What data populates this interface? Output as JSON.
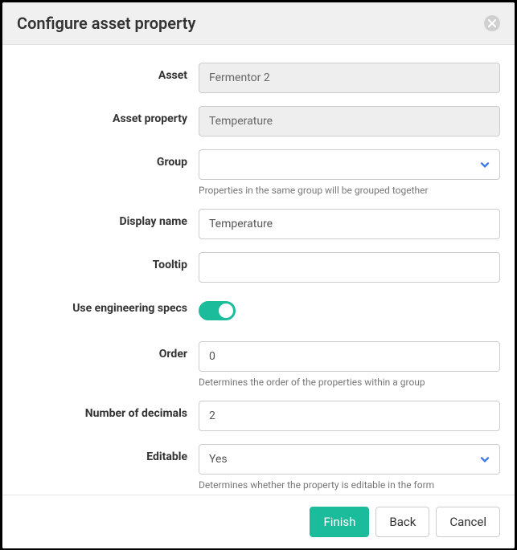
{
  "header": {
    "title": "Configure asset property"
  },
  "form": {
    "asset": {
      "label": "Asset",
      "value": "Fermentor 2"
    },
    "asset_property": {
      "label": "Asset property",
      "value": "Temperature"
    },
    "group": {
      "label": "Group",
      "value": "",
      "help": "Properties in the same group will be grouped together"
    },
    "display_name": {
      "label": "Display name",
      "value": "Temperature"
    },
    "tooltip": {
      "label": "Tooltip",
      "value": ""
    },
    "use_engineering_specs": {
      "label": "Use engineering specs",
      "value": true
    },
    "order": {
      "label": "Order",
      "value": "0",
      "help": "Determines the order of the properties within a group"
    },
    "decimals": {
      "label": "Number of decimals",
      "value": "2"
    },
    "editable": {
      "label": "Editable",
      "value": "Yes",
      "help": "Determines whether the property is editable in the form"
    }
  },
  "footer": {
    "finish": "Finish",
    "back": "Back",
    "cancel": "Cancel"
  }
}
